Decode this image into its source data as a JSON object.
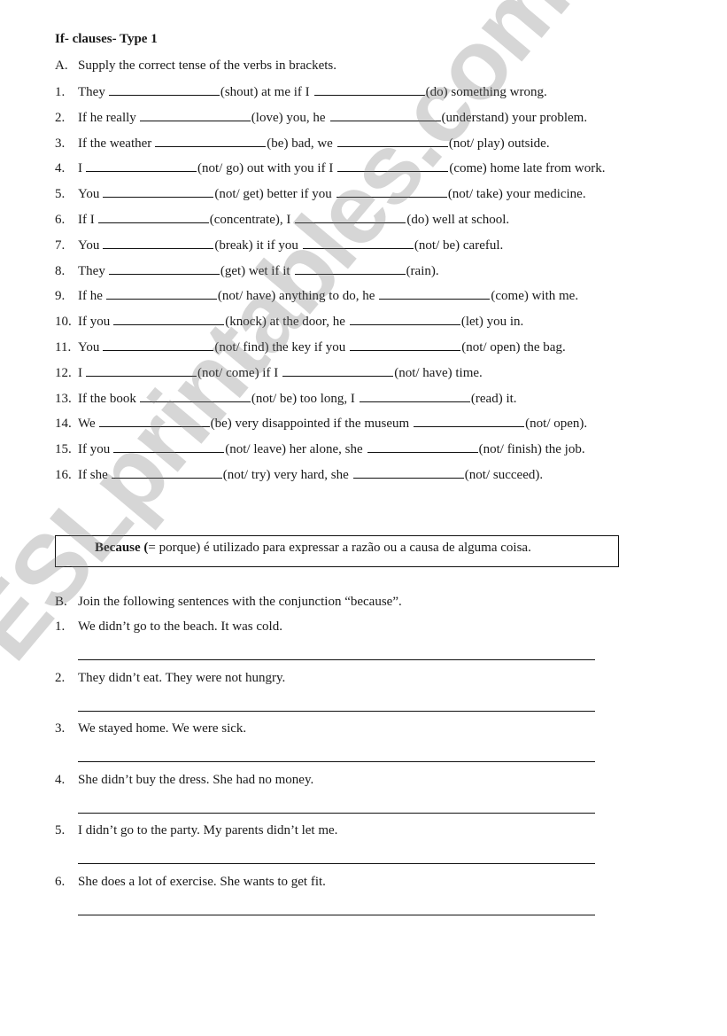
{
  "title": "If- clauses- Type 1",
  "section_a": {
    "letter": "A.",
    "instruction": "Supply the correct tense of the verbs in brackets.",
    "items": [
      {
        "n": "1.",
        "a": "They",
        "b": "(shout) at me if I",
        "c": "(do) something wrong."
      },
      {
        "n": "2.",
        "a": "If he really",
        "b": "(love) you, he",
        "c": "(understand) your problem."
      },
      {
        "n": "3.",
        "a": "If the weather",
        "b": "(be) bad, we",
        "c": "(not/ play) outside."
      },
      {
        "n": "4.",
        "a": "I",
        "b": "(not/ go) out with you if I",
        "c": "(come) home late from work."
      },
      {
        "n": "5.",
        "a": "You",
        "b": "(not/ get) better if you",
        "c": "(not/ take) your medicine."
      },
      {
        "n": "6.",
        "a": "If I",
        "b": "(concentrate), I",
        "c": "(do) well at school."
      },
      {
        "n": "7.",
        "a": "You",
        "b": "(break) it if you",
        "c": "(not/ be) careful."
      },
      {
        "n": "8.",
        "a": "They",
        "b": "(get) wet if it",
        "c": "(rain)."
      },
      {
        "n": "9.",
        "a": "If he",
        "b": "(not/ have) anything to do, he",
        "c": "(come) with me."
      },
      {
        "n": "10.",
        "a": "If you",
        "b": "(knock) at the door, he",
        "c": "(let) you in."
      },
      {
        "n": "11.",
        "a": "You",
        "b": "(not/ find) the key if you",
        "c": "(not/ open) the bag."
      },
      {
        "n": "12.",
        "a": "I",
        "b": "(not/ come) if I",
        "c": "(not/ have) time."
      },
      {
        "n": "13.",
        "a": "If the book",
        "b": "(not/ be) too long, I",
        "c": "(read) it."
      },
      {
        "n": "14.",
        "a": "We",
        "b": "(be) very disappointed if the museum",
        "c": "(not/ open)."
      },
      {
        "n": "15.",
        "a": "If you",
        "b": "(not/ leave) her alone, she",
        "c": "(not/ finish) the job."
      },
      {
        "n": "16.",
        "a": "If she",
        "b": "(not/ try) very hard, she",
        "c": "(not/ succeed)."
      }
    ]
  },
  "info_box": {
    "bold": "Because (",
    "rest": "= porque) é utilizado para expressar a razão ou a causa de alguma coisa."
  },
  "section_b": {
    "letter": "B.",
    "instruction": "Join the following sentences with the conjunction “because”.",
    "items": [
      {
        "n": "1.",
        "text": "We didn’t go to the beach. It was cold."
      },
      {
        "n": "2.",
        "text": "They didn’t eat. They were not hungry."
      },
      {
        "n": "3.",
        "text": "We stayed home. We were sick."
      },
      {
        "n": "4.",
        "text": "She didn’t buy the dress. She had no money."
      },
      {
        "n": "5.",
        "text": "I didn’t go to the party. My parents didn’t let me."
      },
      {
        "n": "6.",
        "text": "She does a lot of exercise. She wants to get fit."
      }
    ]
  },
  "watermark": "ESLprintables.com"
}
